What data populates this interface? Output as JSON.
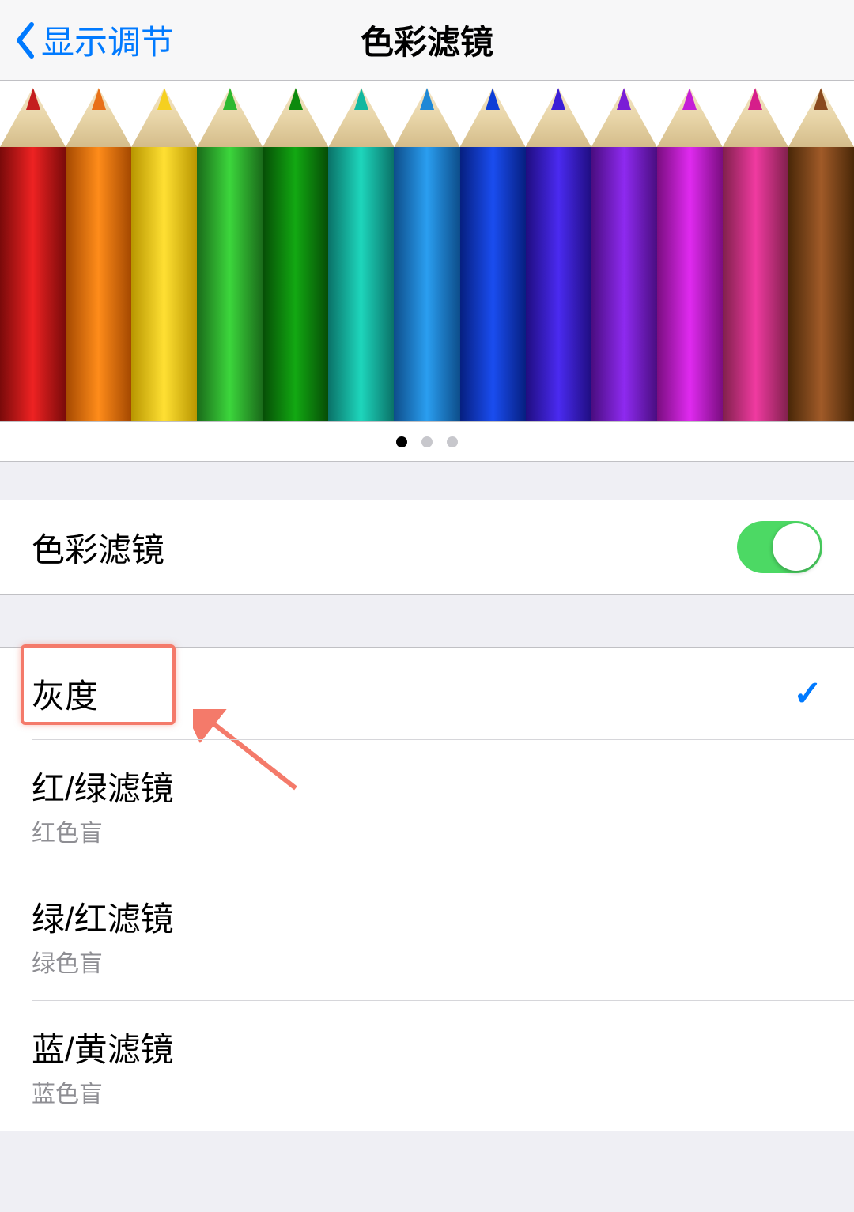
{
  "header": {
    "back_label": "显示调节",
    "title": "色彩滤镜"
  },
  "preview": {
    "pencil_colors": [
      {
        "tip": "#c41e1e",
        "body": "linear-gradient(90deg,#7a0a0a,#e22,#7a0a0a)"
      },
      {
        "tip": "#e87018",
        "body": "linear-gradient(90deg,#a44800,#ff8c1a,#a44800)"
      },
      {
        "tip": "#f5d020",
        "body": "linear-gradient(90deg,#b89600,#ffe033,#b89600)"
      },
      {
        "tip": "#2eb82e",
        "body": "linear-gradient(90deg,#1a6b1a,#3cd63c,#1a6b1a)"
      },
      {
        "tip": "#0d8a0d",
        "body": "linear-gradient(90deg,#064d06,#12a812,#064d06)"
      },
      {
        "tip": "#12b8a0",
        "body": "linear-gradient(90deg,#0a7268,#1ed6bc,#0a7268)"
      },
      {
        "tip": "#1e88d6",
        "body": "linear-gradient(90deg,#0d4d8a,#2a9ef0,#0d4d8a)"
      },
      {
        "tip": "#0d3dd6",
        "body": "linear-gradient(90deg,#061f80,#1a4df0,#061f80)"
      },
      {
        "tip": "#3a1ed6",
        "body": "linear-gradient(90deg,#1f0d80,#4a2af0,#1f0d80)"
      },
      {
        "tip": "#7a1ed6",
        "body": "linear-gradient(90deg,#4a0d80,#8e2af0,#4a0d80)"
      },
      {
        "tip": "#c41ed6",
        "body": "linear-gradient(90deg,#7a0d80,#e02af0,#7a0d80)"
      },
      {
        "tip": "#d61e8a",
        "body": "linear-gradient(90deg,#80204c,#f03aa0,#80204c)"
      },
      {
        "tip": "#8a4a1e",
        "body": "linear-gradient(90deg,#4a2808,#a05a28,#4a2808)"
      }
    ],
    "dots_count": 3,
    "active_dot": 0
  },
  "toggle_row": {
    "label": "色彩滤镜",
    "on": true
  },
  "options": [
    {
      "title": "灰度",
      "subtitle": "",
      "selected": true,
      "highlighted": true
    },
    {
      "title": "红/绿滤镜",
      "subtitle": "红色盲",
      "selected": false,
      "highlighted": false
    },
    {
      "title": "绿/红滤镜",
      "subtitle": "绿色盲",
      "selected": false,
      "highlighted": false
    },
    {
      "title": "蓝/黄滤镜",
      "subtitle": "蓝色盲",
      "selected": false,
      "highlighted": false
    }
  ],
  "colors": {
    "accent": "#007aff",
    "toggle_on": "#4cd964",
    "highlight": "#f47a6a"
  }
}
